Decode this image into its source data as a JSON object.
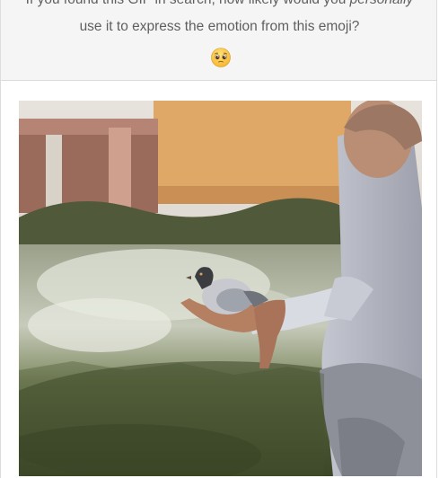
{
  "survey": {
    "question_before": "If you found this GIF in search, how likely would you ",
    "question_emphasis": "personally",
    "question_line2": "use it to express the emotion from this emoji?",
    "emoji_icon": "pleading-face-emoji"
  },
  "gif": {
    "icon": "gif-image"
  }
}
